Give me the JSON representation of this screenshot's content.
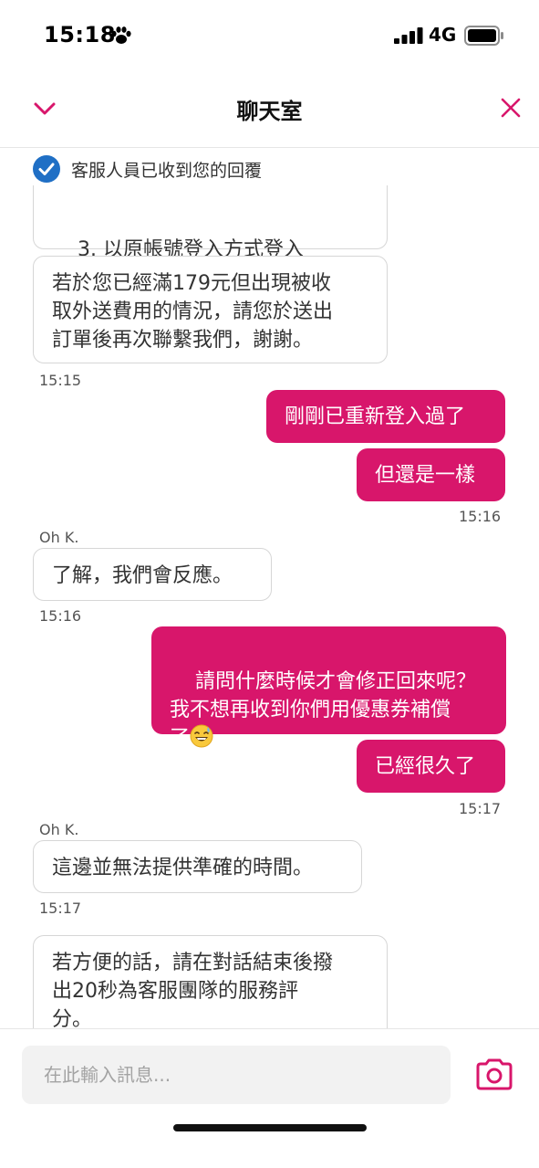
{
  "status": {
    "time": "15:18",
    "network": "4G"
  },
  "header": {
    "title": "聊天室"
  },
  "chat": {
    "receipt": "客服人員已收到您的回覆",
    "messages": {
      "m1": "3. 以原帳號登入方式登入",
      "m2": "若於您已經滿179元但出現被收\n取外送費用的情況，請您於送出\n訂單後再次聯繫我們，謝謝。",
      "t1": "15:15",
      "m3": "剛剛已重新登入過了",
      "m4": "但還是一樣",
      "t2": "15:16",
      "s1": "Oh K.",
      "m5": "了解，我們會反應。",
      "t3": "15:16",
      "m6": "請問什麼時候才會修正回來呢？\n我不想再收到你們用優惠券補償\n了",
      "m7": "已經很久了",
      "t4": "15:17",
      "s2": "Oh K.",
      "m8": "這邊並無法提供準確的時間。",
      "t5": "15:17",
      "m9": "若方便的話，請在對話結束後撥\n出20秒為客服團隊的服務評\n分。"
    }
  },
  "input": {
    "placeholder": "在此輸入訊息..."
  },
  "colors": {
    "accent": "#d8166b",
    "check": "#1f6fc5"
  }
}
